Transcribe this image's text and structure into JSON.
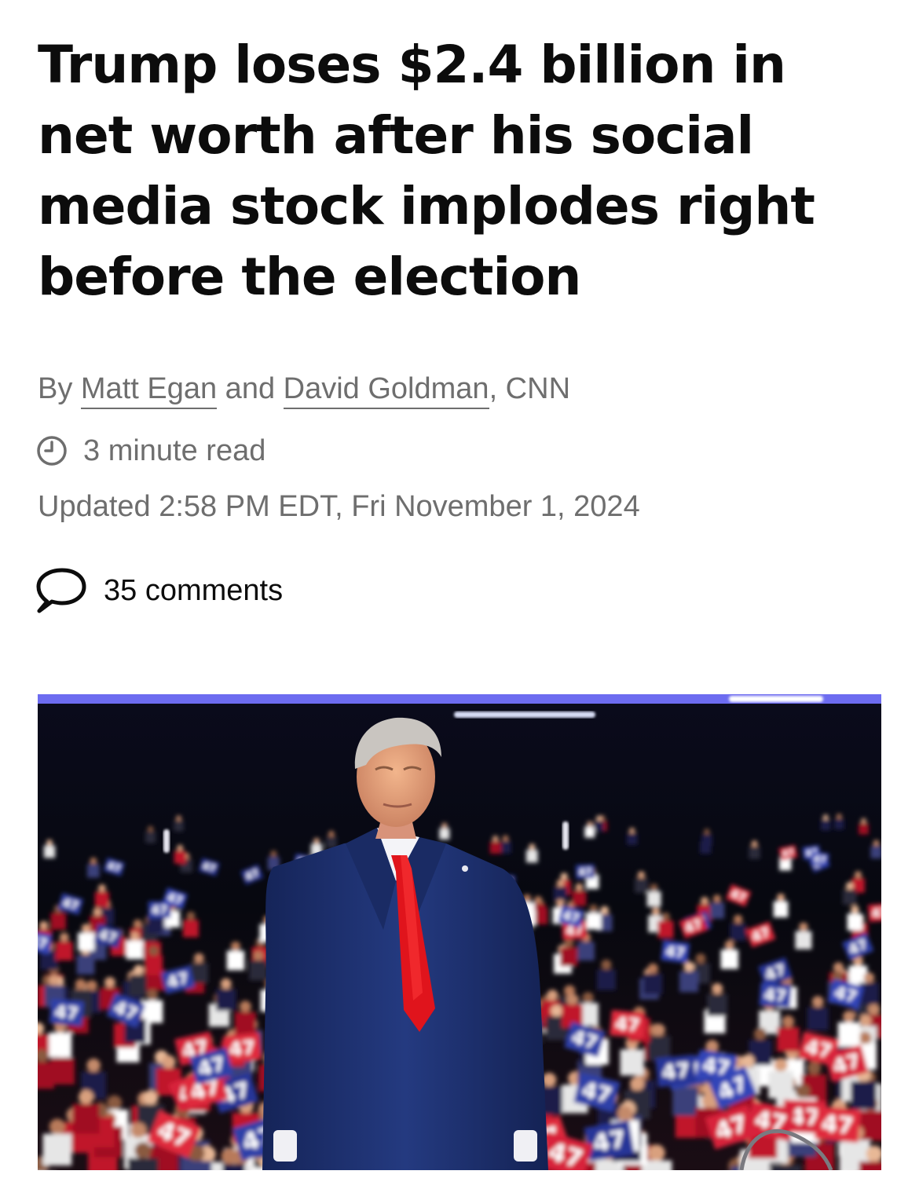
{
  "article": {
    "headline": "Trump loses $2.4 billion in net worth after his social media stock implodes right before the election",
    "byline": {
      "prefix": "By ",
      "author_1": "Matt Egan",
      "joiner": " and ",
      "author_2": "David Goldman",
      "suffix": ", CNN"
    },
    "read_time": "3 minute read",
    "updated": "Updated 2:58 PM EDT, Fri November 1, 2024",
    "comments": "35 comments",
    "hero_image": {
      "sign_text": "47"
    }
  },
  "icons": {
    "clock": "clock-icon",
    "comments": "speech-bubble-icon"
  },
  "colors": {
    "headline": "#0c0c0c",
    "meta": "#6e6e6e",
    "suit": "#1e2f6a",
    "tie": "#e0141c",
    "stage_light": "#6d6cf0"
  }
}
